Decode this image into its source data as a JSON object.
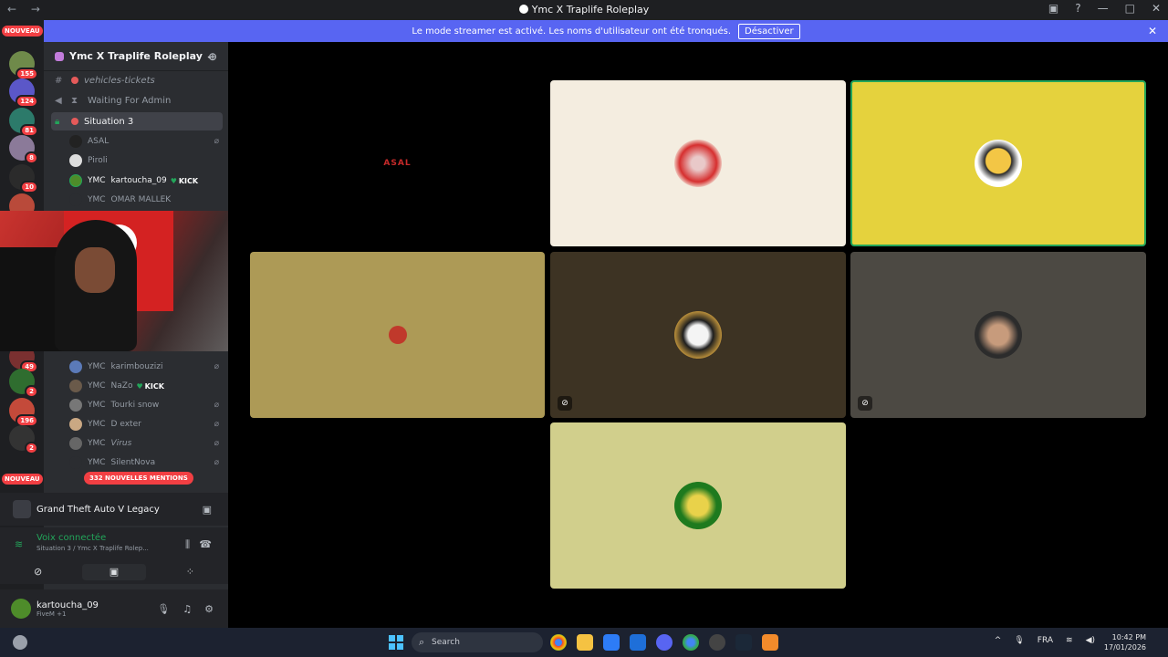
{
  "window": {
    "title": "Ymc X Traplife Roleplay"
  },
  "banner": {
    "text": "Le mode streamer est activé. Les noms d'utilisateur ont été tronqués.",
    "button": "Désactiver"
  },
  "servers": [
    {
      "badge": "NOUVEAU",
      "kind": "nouveau"
    },
    {
      "badge": "155"
    },
    {
      "badge": "124"
    },
    {
      "badge": "81"
    },
    {
      "badge": "8"
    },
    {
      "badge": "10"
    },
    {
      "badge": "49"
    },
    {
      "badge": "2"
    },
    {
      "badge": "196"
    },
    {
      "badge": "2"
    }
  ],
  "server_badges": {
    "b1": "155",
    "b2": "124",
    "b3": "81",
    "b4": "8",
    "b5": "10",
    "b6": "49",
    "b7": "2",
    "b8": "196",
    "b9": "2",
    "nouveau_top": "NOUVEAU",
    "nouveau_bottom": "NOUVEAU"
  },
  "channel_list": {
    "server_name": "Ymc X Traplife Roleplay",
    "channels": [
      {
        "name": "vehicles-tickets"
      },
      {
        "name": "Waiting For Admin"
      },
      {
        "name": "Situation 3"
      }
    ],
    "voice_users": [
      {
        "tag": "",
        "name": "ASAL"
      },
      {
        "tag": "",
        "name": "Piroli"
      },
      {
        "tag": "YMC",
        "name": "kartoucha_09",
        "badge": "KICK"
      },
      {
        "tag": "YMC",
        "name": "OMAR MALLEK"
      },
      {
        "tag": "YMC",
        "name": "karimbouzizi"
      },
      {
        "tag": "YMC",
        "name": "NaZo",
        "badge": "KICK"
      },
      {
        "tag": "YMC",
        "name": "Tourki snow"
      },
      {
        "tag": "YMC",
        "name": "D exter"
      },
      {
        "tag": "YMC",
        "name": "Virus"
      },
      {
        "tag": "YMC",
        "name": "SilentNova"
      }
    ],
    "mentions": "332 NOUVELLES MENTIONS"
  },
  "activity": {
    "game": "Grand Theft Auto V Legacy"
  },
  "voice_status": {
    "status": "Voix connectée",
    "location": "Situation 3 / Ymc X Traplife Rolep..."
  },
  "user_panel": {
    "username": "kartoucha_09",
    "status": "FiveM +1"
  },
  "stage": {
    "tile1_logo": "ASAL"
  },
  "taskbar": {
    "search": "Search",
    "lang": "FRA",
    "time": "10:42 PM",
    "date": "17/01/2026"
  },
  "colors": {
    "accent": "#5865f2",
    "speaking": "#23a55a",
    "mention": "#f23f43"
  }
}
